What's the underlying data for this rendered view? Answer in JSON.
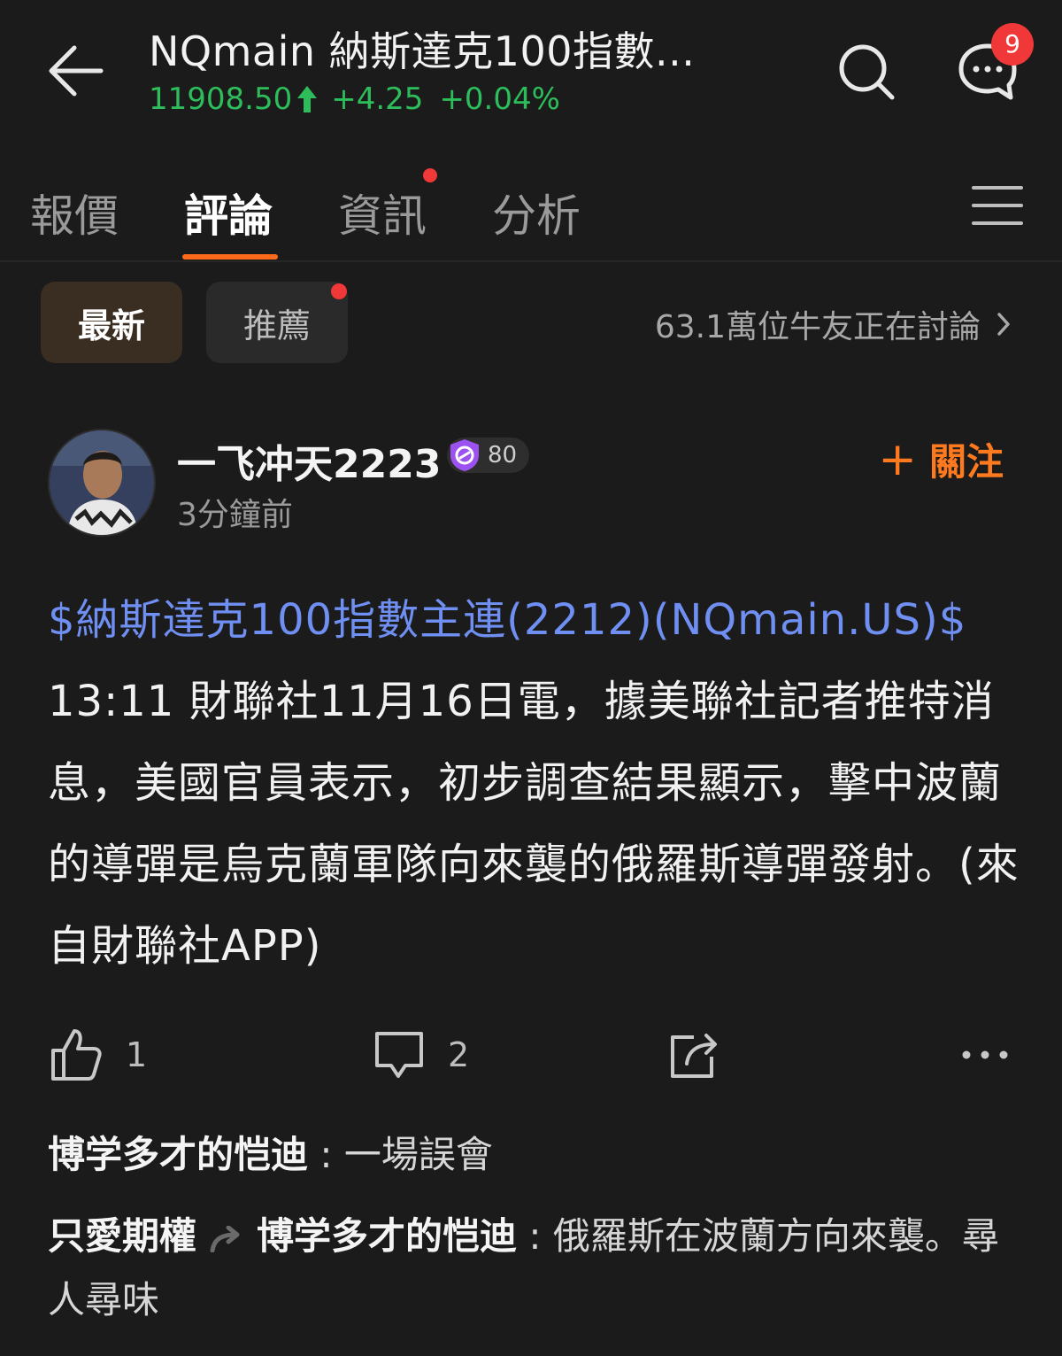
{
  "header": {
    "title": "NQmain  納斯達克100指數...",
    "price": "11908.50",
    "change": "+4.25",
    "change_pct": "+0.04%",
    "up_color": "#2dbd5a",
    "message_badge": "9"
  },
  "tabs": [
    {
      "label": "報價",
      "active": false
    },
    {
      "label": "評論",
      "active": true
    },
    {
      "label": "資訊",
      "active": false,
      "dot": true
    },
    {
      "label": "分析",
      "active": false
    }
  ],
  "filters": {
    "latest": "最新",
    "recommended": "推薦",
    "discussion_count": "63.1萬位牛友正在討論"
  },
  "post": {
    "username": "一飞冲天2223",
    "level": "80",
    "time": "3分鐘前",
    "follow_label": "關注",
    "ticker": "$納斯達克100指數主連(2212)(NQmain.US)$",
    "text": " 13:11 財聯社11月16日電，據美聯社記者推特消息，美國官員表示，初步調查結果顯示，擊中波蘭的導彈是烏克蘭軍隊向來襲的俄羅斯導彈發射。(來自財聯社APP)",
    "likes": "1",
    "comments": "2"
  },
  "comments": [
    {
      "author": "博学多才的恺迪",
      "text": "一場誤會"
    },
    {
      "author": "只愛期權",
      "reply_to": "博学多才的恺迪",
      "text": "俄羅斯在波蘭方向來襲。尋人尋味"
    }
  ],
  "accent_color": "#ff6a1a",
  "link_color": "#6f8ff2"
}
